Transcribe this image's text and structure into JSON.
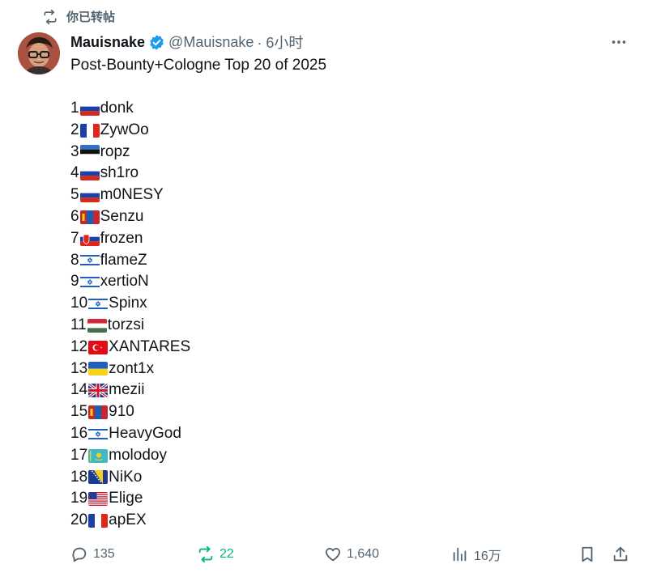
{
  "repost_banner": {
    "text": "你已转帖"
  },
  "author": {
    "display_name": "Mauisnake",
    "handle": "@Mauisnake",
    "time": "· 6小时"
  },
  "tweet": {
    "title": "Post-Bounty+Cologne Top 20 of 2025",
    "rankings": [
      {
        "rank": "1",
        "flag": "russia",
        "name": "donk"
      },
      {
        "rank": "2",
        "flag": "france",
        "name": "ZywOo"
      },
      {
        "rank": "3",
        "flag": "estonia",
        "name": "ropz"
      },
      {
        "rank": "4",
        "flag": "russia",
        "name": "sh1ro"
      },
      {
        "rank": "5",
        "flag": "russia",
        "name": "m0NESY"
      },
      {
        "rank": "6",
        "flag": "mongolia",
        "name": "Senzu"
      },
      {
        "rank": "7",
        "flag": "slovakia",
        "name": "frozen"
      },
      {
        "rank": "8",
        "flag": "israel",
        "name": "flameZ"
      },
      {
        "rank": "9",
        "flag": "israel",
        "name": "xertioN"
      },
      {
        "rank": "10",
        "flag": "israel",
        "name": "Spinx"
      },
      {
        "rank": "11",
        "flag": "hungary",
        "name": "torzsi"
      },
      {
        "rank": "12",
        "flag": "turkey",
        "name": "XANTARES"
      },
      {
        "rank": "13",
        "flag": "ukraine",
        "name": "zont1x"
      },
      {
        "rank": "14",
        "flag": "uk",
        "name": "mezii"
      },
      {
        "rank": "15",
        "flag": "mongolia",
        "name": "910"
      },
      {
        "rank": "16",
        "flag": "israel",
        "name": "HeavyGod"
      },
      {
        "rank": "17",
        "flag": "kazakhstan",
        "name": "molodoy"
      },
      {
        "rank": "18",
        "flag": "bosnia",
        "name": "NiKo"
      },
      {
        "rank": "19",
        "flag": "usa",
        "name": "Elige"
      },
      {
        "rank": "20",
        "flag": "france",
        "name": "apEX"
      }
    ]
  },
  "actions": {
    "replies": "135",
    "reposts": "22",
    "likes": "1,640",
    "views": "16万"
  },
  "icons": {
    "repost": "repost-icon",
    "verified": "verified-badge-icon",
    "more": "more-icon",
    "reply": "reply-icon",
    "like": "heart-icon",
    "views": "views-chart-icon",
    "bookmark": "bookmark-icon",
    "share": "share-icon"
  },
  "colors": {
    "text": "#0f1419",
    "secondary": "#536471",
    "verified": "#1d9bf0",
    "repost_active": "#00ba7c"
  }
}
